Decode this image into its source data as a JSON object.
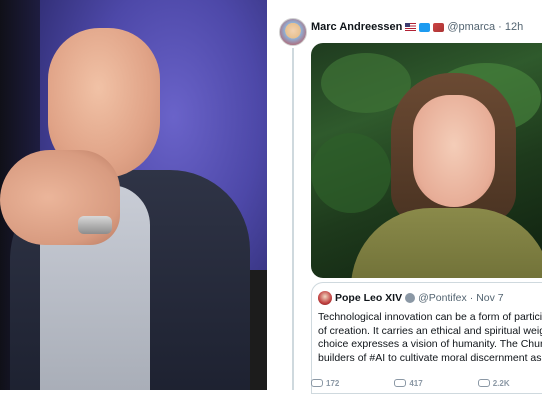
{
  "tweet": {
    "author_name": "Marc Andreessen",
    "author_handle": "@pmarca",
    "separator": "·",
    "time": "12h",
    "icons": [
      "flag-icon",
      "bird-icon",
      "pill-icon"
    ],
    "quoted": {
      "author_name": "Pope Leo XIV",
      "author_handle": "@Pontifex",
      "separator": "·",
      "date": "Nov 7",
      "text_lines": [
        "Technological innovation can be a form of participat",
        "of creation. It carries an ethical and spiritual weight,",
        "choice expresses a vision of humanity. The Church t",
        "builders of #AI to cultivate moral discernment as a"
      ]
    },
    "footer": {
      "replies": "172",
      "reposts": "417",
      "likes": "2.2K"
    }
  },
  "colors": {
    "link_gray": "#536471",
    "divider": "#cfd9de",
    "twitter_blue": "#1d9bf0"
  }
}
